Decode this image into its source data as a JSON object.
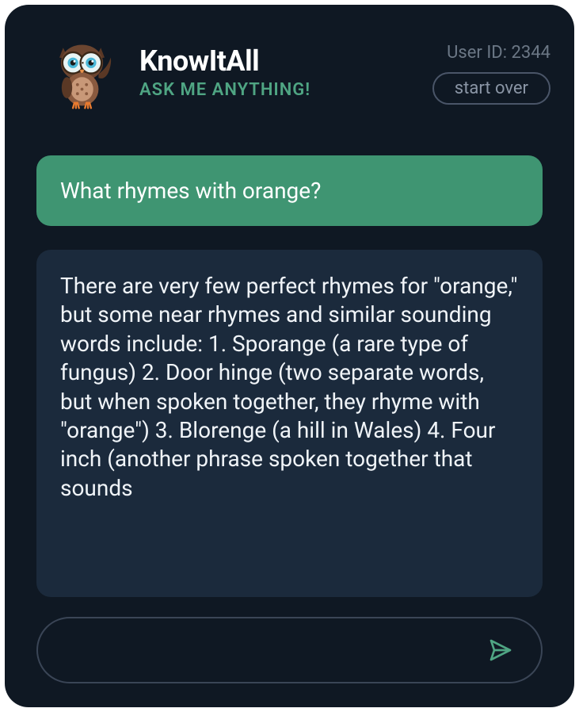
{
  "header": {
    "title": "KnowItAll",
    "subtitle": "ASK ME ANYTHING!",
    "user_id_label": "User ID: 2344",
    "start_over_label": "start over"
  },
  "messages": {
    "user": "What rhymes with orange?",
    "bot": "There are very few perfect rhymes for \"orange,\" but some near rhymes and similar sounding words include: 1. Sporange (a rare type of fungus) 2. Door hinge (two separate words, but when spoken together, they rhyme with \"orange\") 3. Blorenge (a hill in Wales) 4. Four inch (another phrase spoken together that sounds"
  },
  "input": {
    "placeholder": ""
  }
}
